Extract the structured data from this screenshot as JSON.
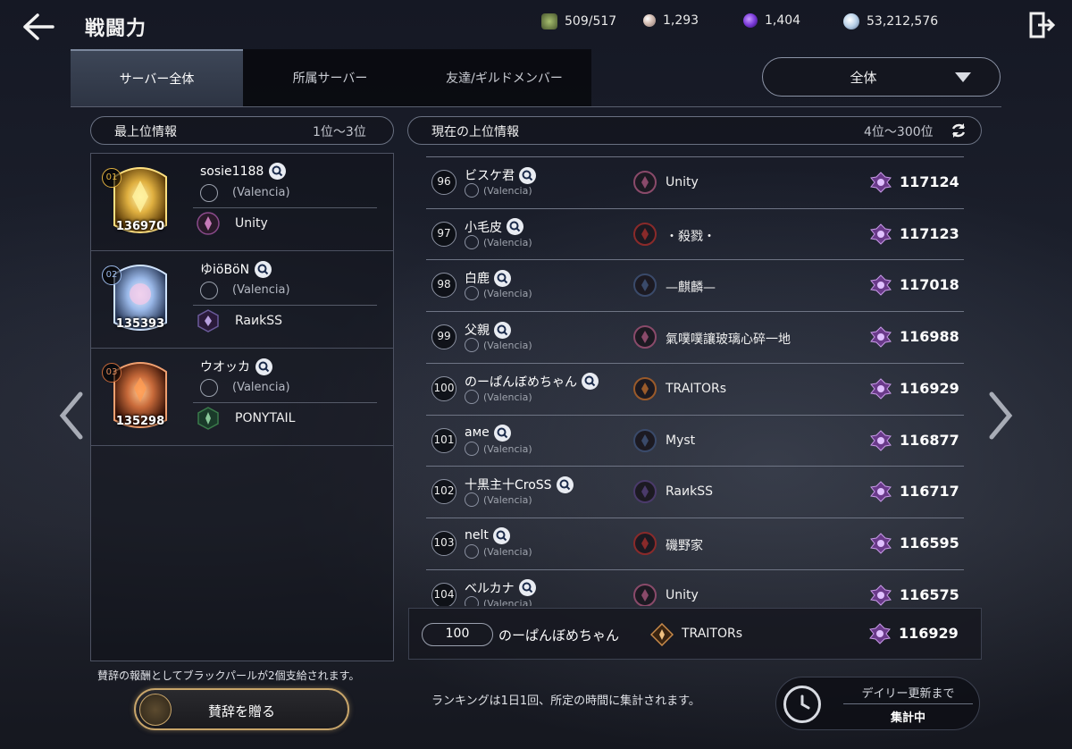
{
  "header": {
    "title": "戦闘力",
    "currencies": [
      {
        "icon": "energy-icon",
        "value": "509/517",
        "color": "#8aa05a"
      },
      {
        "icon": "pearl-icon",
        "value": "1,293",
        "color": "#d8c2b8"
      },
      {
        "icon": "crystal-icon",
        "value": "1,404",
        "color": "#7a3ad8"
      },
      {
        "icon": "silver-icon",
        "value": "53,212,576",
        "color": "#b8d0e8"
      }
    ]
  },
  "tabs": [
    {
      "label": "サーバー全体",
      "active": true
    },
    {
      "label": "所属サーバー",
      "active": false
    },
    {
      "label": "友達/ギルドメンバー",
      "active": false
    }
  ],
  "filter": {
    "selected": "全体"
  },
  "top_section": {
    "title": "最上位情報",
    "range": "1位～3位"
  },
  "current_section": {
    "title": "現在の上位情報",
    "range": "4位～300位"
  },
  "top3": [
    {
      "rank": "01",
      "score": "136970",
      "name": "sosie1188",
      "server": "(Valencia)",
      "guild": "Unity",
      "medal_color": "#e0b040",
      "guild_color": "#8a4a8a"
    },
    {
      "rank": "02",
      "score": "135393",
      "name": "ゆiöBöN",
      "server": "(Valencia)",
      "guild": "RaиkSS",
      "medal_color": "#9ab8e8",
      "guild_color": "#4a3a6a"
    },
    {
      "rank": "03",
      "score": "135298",
      "name": "ウオッカ",
      "server": "(Valencia)",
      "guild": "PONYTAIL",
      "medal_color": "#c86a3a",
      "guild_color": "#3a7a4a"
    }
  ],
  "rankings": [
    {
      "rank": "96",
      "name": "ビスケ君",
      "server": "(Valencia)",
      "guild": "Unity",
      "power": "117124",
      "guild_color": "#8a4a6a"
    },
    {
      "rank": "97",
      "name": "小毛皮",
      "server": "(Valencia)",
      "guild": "・殺戮・",
      "power": "117123",
      "guild_color": "#8a2a2a"
    },
    {
      "rank": "98",
      "name": "白鹿",
      "server": "(Valencia)",
      "guild": "—麒麟—",
      "power": "117018",
      "guild_color": "#3a4a6a"
    },
    {
      "rank": "99",
      "name": "父親",
      "server": "(Valencia)",
      "guild": "氣噗噗讓玻璃心碎一地",
      "power": "116988",
      "guild_color": "#8a4a6a"
    },
    {
      "rank": "100",
      "name": "のーぱんぼめちゃん",
      "server": "(Valencia)",
      "guild": "TRAITORs",
      "power": "116929",
      "guild_color": "#9a5a2a"
    },
    {
      "rank": "101",
      "name": "aмe",
      "server": "(Valencia)",
      "guild": "Myst",
      "power": "116877",
      "guild_color": "#3a4a6a"
    },
    {
      "rank": "102",
      "name": "十黒主十CroSS",
      "server": "(Valencia)",
      "guild": "RaиkSS",
      "power": "116717",
      "guild_color": "#4a3a6a"
    },
    {
      "rank": "103",
      "name": "nelt",
      "server": "(Valencia)",
      "guild": "磯野家",
      "power": "116595",
      "guild_color": "#8a2a2a"
    },
    {
      "rank": "104",
      "name": "ベルカナ",
      "server": "(Valencia)",
      "guild": "Unity",
      "power": "116575",
      "guild_color": "#8a4a6a"
    }
  ],
  "my_rank": {
    "rank": "100",
    "name": "のーぱんぼめちゃん",
    "guild": "TRAITORs",
    "power": "116929"
  },
  "footer": {
    "reward_note": "賛辞の報酬としてブラックパールが2個支給されます。",
    "praise_button": "賛辞を贈る",
    "ranking_note": "ランキングは1日1回、所定の時間に集計されます。",
    "daily_title": "デイリー更新まで",
    "daily_status": "集計中"
  }
}
